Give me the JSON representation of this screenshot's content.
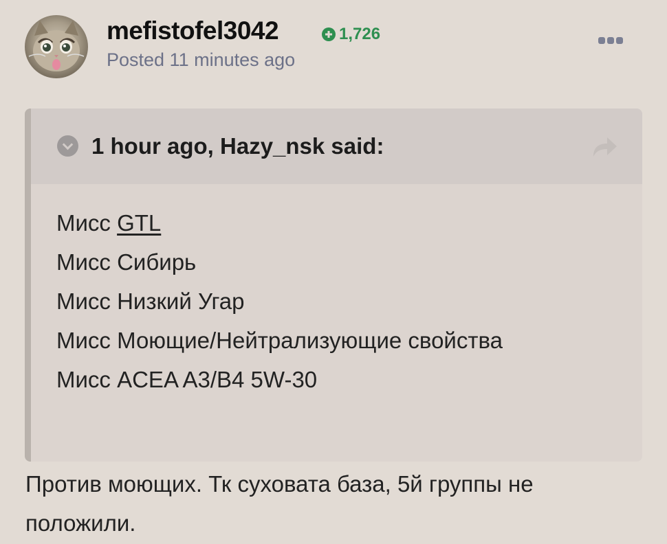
{
  "post": {
    "author": "mefistofel3042",
    "reputation": "1,726",
    "posted": "Posted 11 minutes ago"
  },
  "quote": {
    "title": "1 hour ago, Hazy_nsk said:",
    "lines": [
      {
        "prefix": "Мисс ",
        "link": "GTL"
      },
      {
        "text": "Мисс Сибирь"
      },
      {
        "text": "Мисс Низкий Угар"
      },
      {
        "text": "Мисс Моющие/Нейтрализующие свойства"
      },
      {
        "text": "Мисс ACEA A3/B4 5W-30"
      }
    ]
  },
  "reply": {
    "text": "Против моющих. Тк суховата база, 5й группы не положили."
  },
  "icons": {
    "avatar": "user-avatar",
    "reputation": "plus-circle-icon",
    "more": "more-options-icon",
    "collapse": "chevron-down-circle-icon",
    "share": "share-arrow-icon"
  },
  "colors": {
    "background": "#e2dbd4",
    "reputation": "#2e8f50",
    "meta": "#6c7188",
    "quote_bg": "#dcd4cf",
    "quote_header_bg": "#d2cbc8"
  }
}
